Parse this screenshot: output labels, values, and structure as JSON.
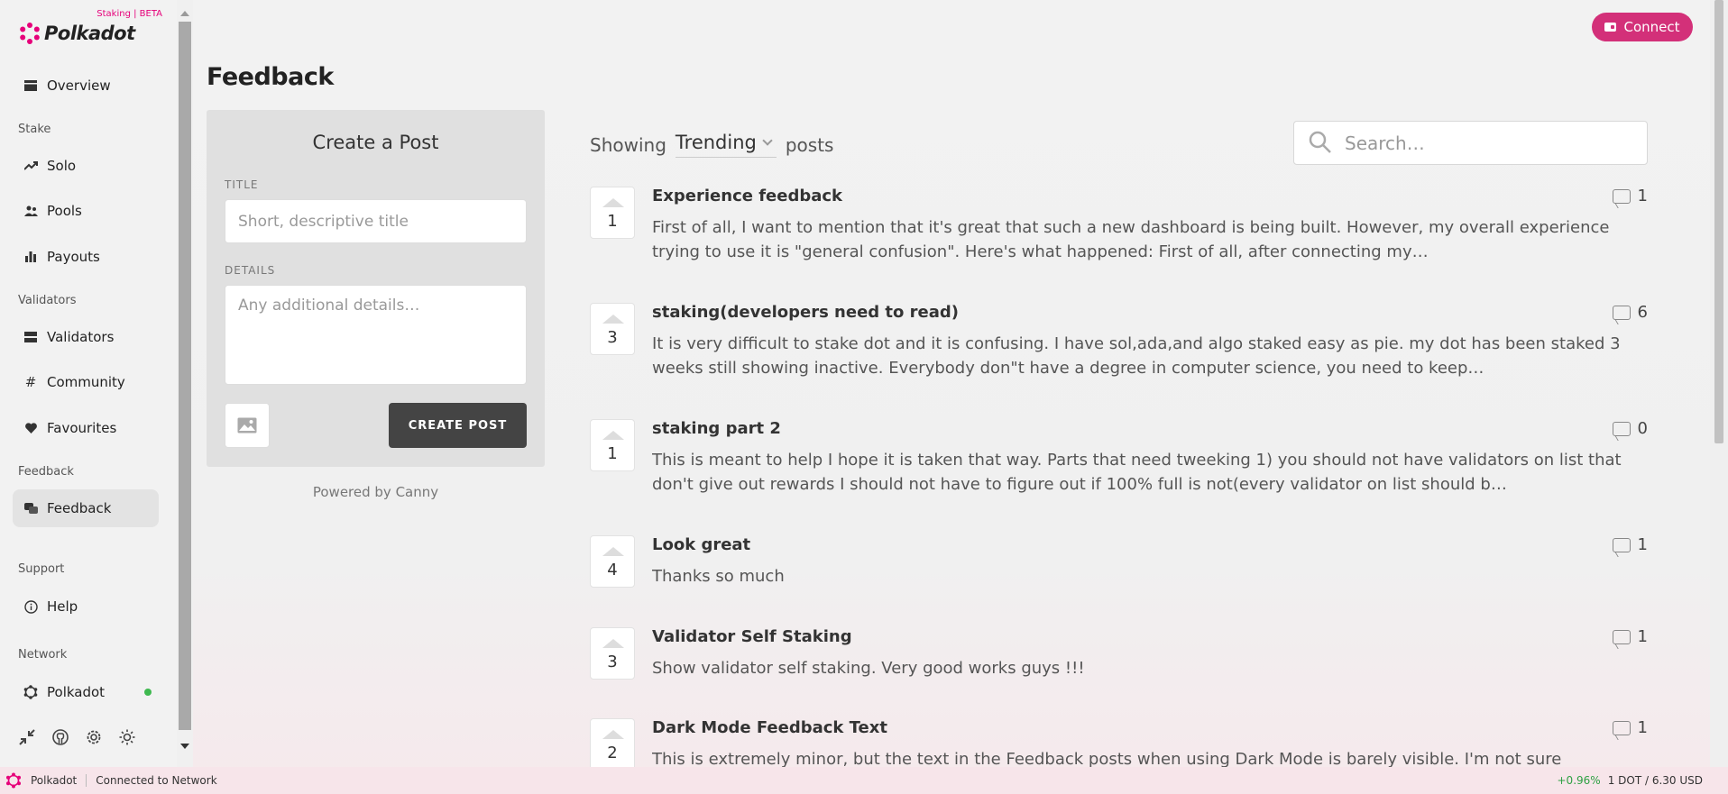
{
  "app": {
    "name": "Polkadot",
    "badge": "Staking | BETA",
    "brand_color": "#e6007a"
  },
  "sidebar": {
    "overview": "Overview",
    "sections": {
      "stake": "Stake",
      "validators": "Validators",
      "feedback": "Feedback",
      "support": "Support",
      "network": "Network"
    },
    "items": {
      "solo": "Solo",
      "pools": "Pools",
      "payouts": "Payouts",
      "validators": "Validators",
      "community": "Community",
      "favourites": "Favourites",
      "feedback": "Feedback",
      "help": "Help",
      "network": "Polkadot"
    },
    "network_status_color": "#3fb950",
    "tools": [
      "collapse-icon",
      "github-icon",
      "settings-icon",
      "theme-icon"
    ]
  },
  "header": {
    "connect_label": "Connect",
    "page_title": "Feedback"
  },
  "create_post": {
    "title": "Create a Post",
    "title_label": "TITLE",
    "title_placeholder": "Short, descriptive title",
    "details_label": "DETAILS",
    "details_placeholder": "Any additional details…",
    "submit_label": "CREATE POST",
    "powered_by": "Powered by Canny"
  },
  "feed": {
    "showing_label": "Showing",
    "sort_value": "Trending",
    "posts_label": "posts",
    "search_placeholder": "Search…",
    "posts": [
      {
        "votes": "1",
        "title": "Experience feedback",
        "body": "First of all, I want to mention that it's great that such a new dashboard is being built. However, my overall experience trying to use it is \"general confusion\". Here's what happened: First of all, after connecting my…",
        "comments": "1"
      },
      {
        "votes": "3",
        "title": "staking(developers need to read)",
        "body": "It is very difficult to stake dot and it is confusing. I have sol,ada,and algo staked easy as pie. my dot has been staked 3 weeks still showing inactive. Everybody don\"t have a degree in computer science, you need to keep…",
        "comments": "6"
      },
      {
        "votes": "1",
        "title": "staking part 2",
        "body": "This is meant to help I hope it is taken that way. Parts that need tweeking 1) you should not have validators on list that don't give out rewards I should not have to figure out if 100% full is not(every validator on list should b…",
        "comments": "0"
      },
      {
        "votes": "4",
        "title": "Look great",
        "body": "Thanks so much",
        "comments": "1"
      },
      {
        "votes": "3",
        "title": "Validator Self Staking",
        "body": "Show validator self staking. Very good works guys !!!",
        "comments": "1"
      },
      {
        "votes": "2",
        "title": "Dark Mode Feedback Text",
        "body": "This is extremely minor, but the text in the Feedback posts when using Dark Mode is barely visible. I'm not sure",
        "comments": "1"
      }
    ]
  },
  "statusbar": {
    "network": "Polkadot",
    "connection": "Connected to Network",
    "price_change": "+0.96%",
    "price": "1 DOT / 6.30 USD"
  }
}
